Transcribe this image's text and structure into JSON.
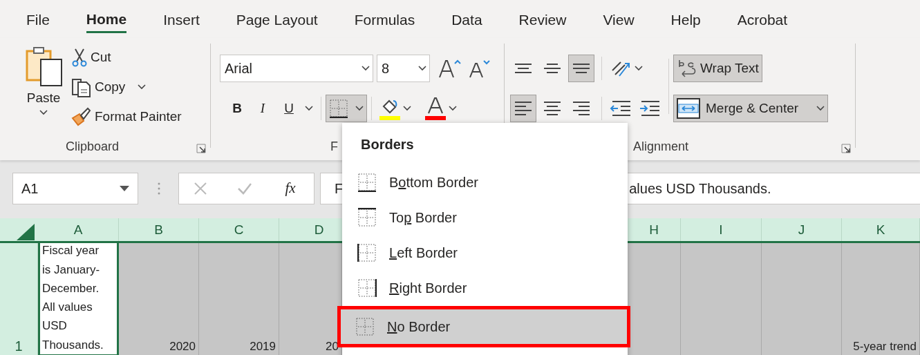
{
  "tabs": [
    {
      "label": "File",
      "selected": false
    },
    {
      "label": "Home",
      "selected": true
    },
    {
      "label": "Insert",
      "selected": false
    },
    {
      "label": "Page Layout",
      "selected": false
    },
    {
      "label": "Formulas",
      "selected": false
    },
    {
      "label": "Data",
      "selected": false
    },
    {
      "label": "Review",
      "selected": false
    },
    {
      "label": "View",
      "selected": false
    },
    {
      "label": "Help",
      "selected": false
    },
    {
      "label": "Acrobat",
      "selected": false
    }
  ],
  "clipboard": {
    "paste": "Paste",
    "cut": "Cut",
    "copy": "Copy",
    "format_painter": "Format Painter",
    "group_label": "Clipboard"
  },
  "font": {
    "font_name": "Arial",
    "font_size": "8",
    "bold": "B",
    "italic": "I",
    "underline": "U",
    "borders_expanded": true,
    "group_label": "F"
  },
  "alignment": {
    "vertical": [
      {
        "kind": "top",
        "selected": false
      },
      {
        "kind": "middle",
        "selected": false
      },
      {
        "kind": "bottom",
        "selected": true
      }
    ],
    "horizontal": [
      {
        "kind": "left",
        "selected": true
      },
      {
        "kind": "center",
        "selected": false
      },
      {
        "kind": "right",
        "selected": false
      }
    ],
    "wrap_text": {
      "label": "Wrap Text",
      "on": true
    },
    "merge_center": {
      "label": "Merge & Center",
      "on": true
    },
    "group_label": "Alignment"
  },
  "formula_bar": {
    "name_box": "A1",
    "function_label": "fx",
    "formula_start": "F",
    "formula_end": "alues USD Thousands."
  },
  "sheet": {
    "columns": [
      "A",
      "B",
      "C",
      "D",
      "H",
      "I",
      "J",
      "K"
    ],
    "rows": [
      {
        "header": "1",
        "cells": [
          {
            "text": "Fiscal year is January-December. All values USD Thousands.",
            "selected": true
          },
          {
            "text": "2020",
            "selected": false
          },
          {
            "text": "2019",
            "selected": false
          },
          {
            "text": "20",
            "selected": false
          },
          {
            "selected": false
          },
          {
            "selected": false
          },
          {
            "selected": false
          },
          {
            "text": "5-year trend",
            "selected": false
          }
        ]
      }
    ]
  },
  "borders_menu": {
    "title": "Borders",
    "items": [
      {
        "kind": "bottom",
        "prefix": "B",
        "access_key": "o",
        "suffix": "ttom Border",
        "selected": false,
        "annotated": false
      },
      {
        "kind": "top",
        "prefix": "To",
        "access_key": "p",
        "suffix": " Border",
        "selected": false,
        "annotated": false
      },
      {
        "kind": "left",
        "access_key": "L",
        "suffix": "eft Border",
        "selected": false,
        "annotated": false
      },
      {
        "kind": "right",
        "access_key": "R",
        "suffix": "ight Border",
        "selected": false,
        "annotated": false
      },
      {
        "kind": "none",
        "access_key": "N",
        "suffix": "o Border",
        "selected": true,
        "annotated": true
      }
    ]
  }
}
